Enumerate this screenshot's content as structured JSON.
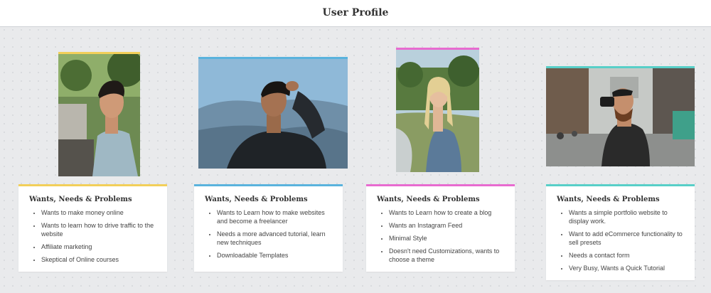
{
  "header": {
    "title": "User Profile"
  },
  "personas": [
    {
      "accent": "#f2cf5a",
      "heading": "Wants, Needs & Problems",
      "items": [
        "Wants to make money online",
        "Wants to learn how to drive traffic to the website",
        "Affiliate marketing",
        "Skeptical of Online courses"
      ]
    },
    {
      "accent": "#5ab3dd",
      "heading": "Wants, Needs & Problems",
      "items": [
        "Wants to Learn how to make websites and become a freelancer",
        "Needs a more advanced tutorial, learn new techniques",
        "Downloadable Templates"
      ]
    },
    {
      "accent": "#e86bd0",
      "heading": "Wants, Needs & Problems",
      "items": [
        "Wants to Learn how to create a blog",
        "Wants an Instagram Feed",
        "Minimal Style",
        "Doesn't need Customizations, wants to choose a theme"
      ]
    },
    {
      "accent": "#58cfc8",
      "heading": "Wants, Needs & Problems",
      "items": [
        "Wants a simple portfolio website to display work.",
        "Want to add eCommerce functionality to sell presets",
        "Needs a contact form",
        "Very Busy, Wants a Quick Tutorial"
      ]
    }
  ]
}
